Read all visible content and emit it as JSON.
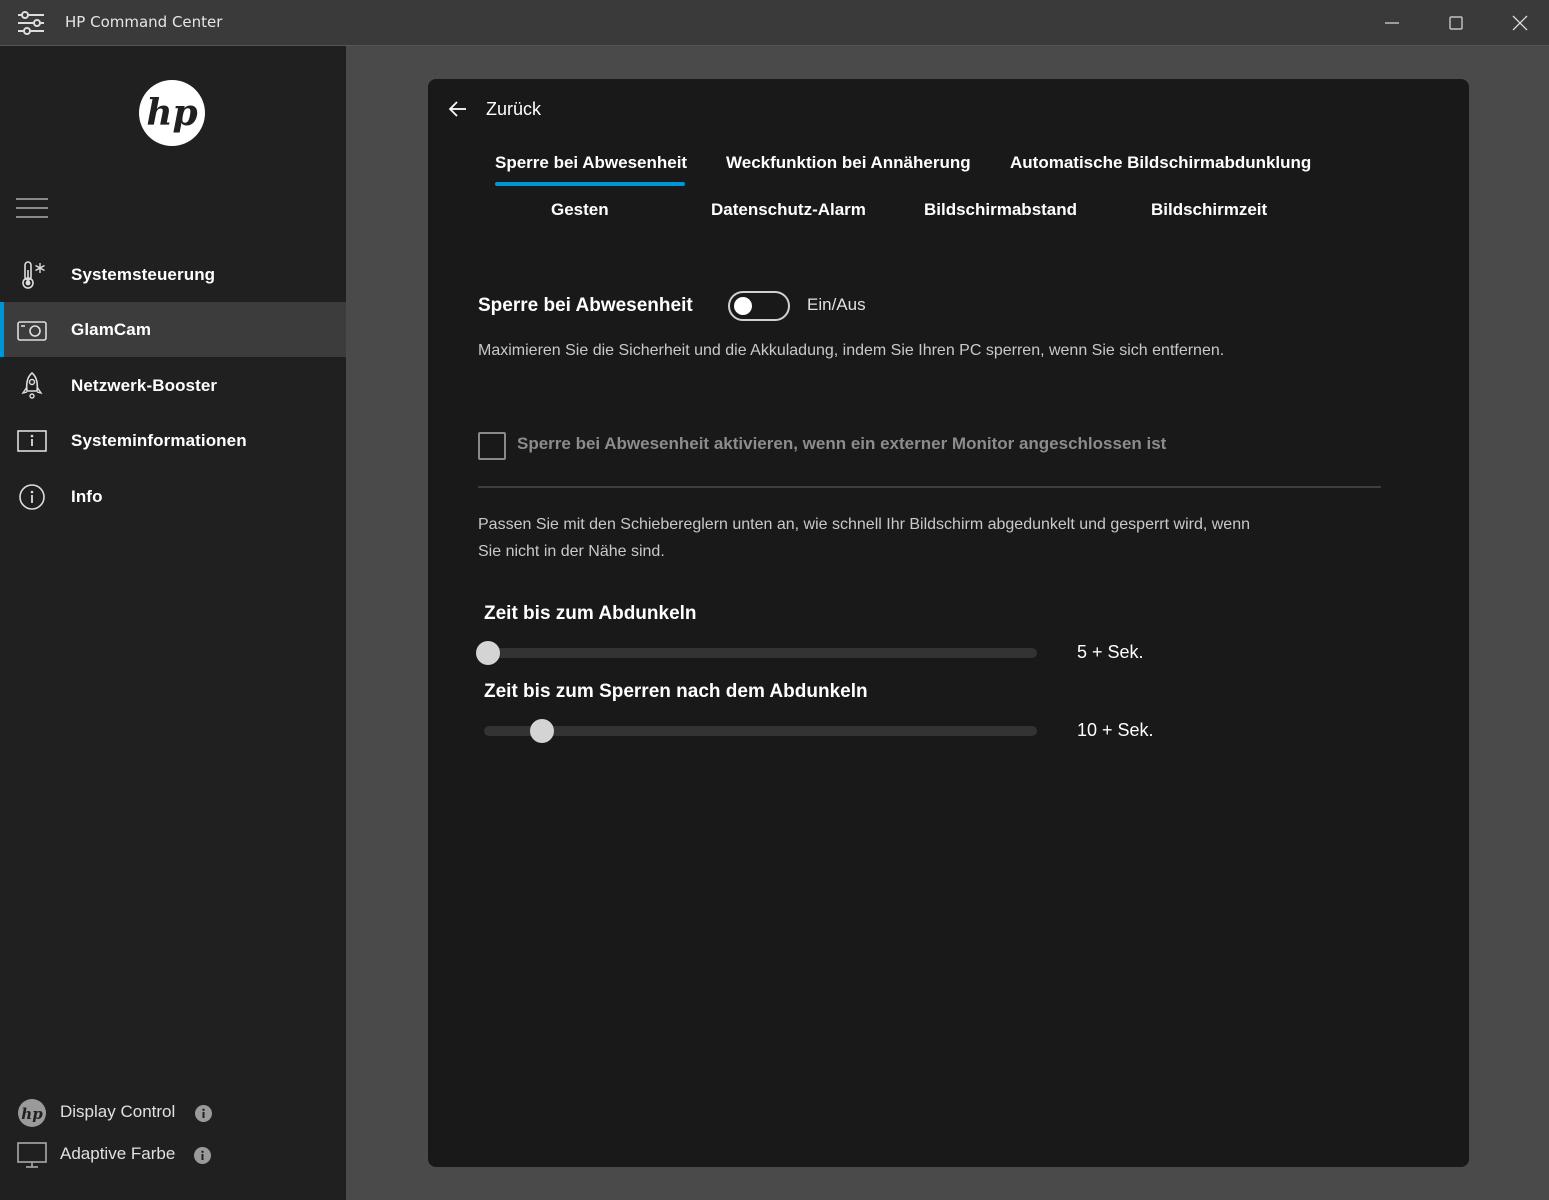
{
  "window": {
    "title": "HP Command Center"
  },
  "sidebar": {
    "items": [
      {
        "label": "Systemsteuerung",
        "icon": "thermometer-snowflake-icon",
        "active": false
      },
      {
        "label": "GlamCam",
        "icon": "camera-icon",
        "active": true
      },
      {
        "label": "Netzwerk-Booster",
        "icon": "rocket-icon",
        "active": false
      },
      {
        "label": "Systeminformationen",
        "icon": "info-box-icon",
        "active": false
      },
      {
        "label": "Info",
        "icon": "info-circle-icon",
        "active": false
      }
    ],
    "bottom": [
      {
        "label": "Display Control",
        "icon": "hp-logo-icon"
      },
      {
        "label": "Adaptive Farbe",
        "icon": "monitor-icon"
      }
    ]
  },
  "main": {
    "back_label": "Zurück",
    "tabs": [
      "Sperre bei Abwesenheit",
      "Weckfunktion bei Annäherung",
      "Automatische Bildschirmabdunklung",
      "Gesten",
      "Datenschutz-Alarm",
      "Bildschirmabstand",
      "Bildschirmzeit"
    ],
    "active_tab": "Sperre bei Abwesenheit",
    "section_title": "Sperre bei Abwesenheit",
    "toggle_label": "Ein/Aus",
    "toggle_on": false,
    "description_1": "Maximieren Sie die Sicherheit und die Akkuladung, indem Sie Ihren PC sperren, wenn Sie sich entfernen.",
    "checkbox_label": "Sperre bei Abwesenheit aktivieren, wenn ein externer Monitor angeschlossen ist",
    "checkbox_checked": false,
    "description_2": "Passen Sie mit den Schiebereglern unten an, wie schnell Ihr Bildschirm abgedunkelt und gesperrt wird, wenn Sie nicht in der Nähe sind.",
    "sliders": [
      {
        "label": "Zeit bis zum Abdunkeln",
        "value_text": "5 + Sek.",
        "fraction": 0.0
      },
      {
        "label": "Zeit bis zum Sperren nach dem Abdunkeln",
        "value_text": "10 + Sek.",
        "fraction": 0.1
      }
    ]
  },
  "colors": {
    "accent": "#0096d6",
    "sidebar_bg": "#202020",
    "panel_bg": "#191919",
    "window_bg": "#4a4a4a"
  }
}
